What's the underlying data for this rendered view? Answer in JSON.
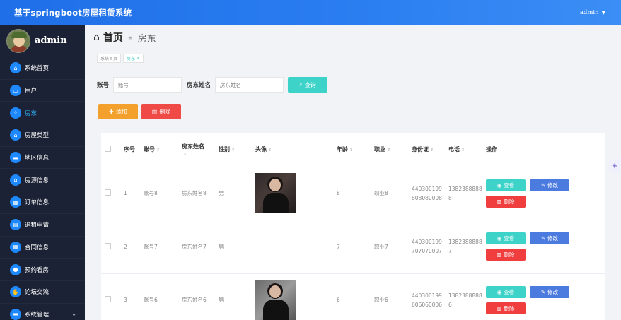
{
  "app": {
    "title": "基于springboot房屋租赁系统",
    "user": "admin"
  },
  "sidebar": {
    "username": "admin",
    "items": [
      {
        "label": "系统首页",
        "icon": "house"
      },
      {
        "label": "用户",
        "icon": "monitor"
      },
      {
        "label": "房东",
        "icon": "dots-grid",
        "active": true
      },
      {
        "label": "房屋类型",
        "icon": "house"
      },
      {
        "label": "地区信息",
        "icon": "chat-bubble"
      },
      {
        "label": "房源信息",
        "icon": "house"
      },
      {
        "label": "订单信息",
        "icon": "grid"
      },
      {
        "label": "退租申请",
        "icon": "clipboard"
      },
      {
        "label": "合同信息",
        "icon": "grid"
      },
      {
        "label": "预约看房",
        "icon": "person"
      },
      {
        "label": "论坛交流",
        "icon": "thumbs-up"
      },
      {
        "label": "系统管理",
        "icon": "chat-bubble"
      }
    ]
  },
  "page": {
    "title": "首页",
    "subtitle": "房东",
    "tags": [
      {
        "label": "系统首页"
      },
      {
        "label": "房东"
      }
    ]
  },
  "search": {
    "account_label": "账号",
    "account_placeholder": "账号",
    "name_label": "房东姓名",
    "name_placeholder": "房东姓名",
    "query_button": "查询"
  },
  "toolbar": {
    "add_button": "添加",
    "delete_button": "删除"
  },
  "table": {
    "headers": [
      "序号",
      "账号",
      "房东姓名",
      "性别",
      "头像",
      "年龄",
      "职业",
      "身份证",
      "电话",
      "操作"
    ],
    "rows": [
      {
        "index": "1",
        "account": "账号8",
        "name": "房东姓名8",
        "gender": "男",
        "has_photo": true,
        "age": "8",
        "job": "职业8",
        "id_card": "440300199808080008",
        "phone": "13823888888"
      },
      {
        "index": "2",
        "account": "账号7",
        "name": "房东姓名7",
        "gender": "男",
        "has_photo": false,
        "age": "7",
        "job": "职业7",
        "id_card": "440300199707070007",
        "phone": "13823888887"
      },
      {
        "index": "3",
        "account": "账号6",
        "name": "房东姓名6",
        "gender": "男",
        "has_photo": true,
        "age": "6",
        "job": "职业6",
        "id_card": "440300199606060006",
        "phone": "13823888886"
      }
    ],
    "actions": {
      "view": "查看",
      "edit": "修改",
      "delete": "删除"
    }
  }
}
